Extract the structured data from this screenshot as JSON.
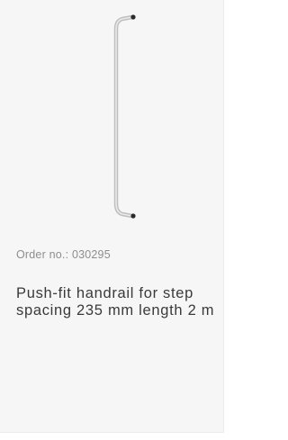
{
  "product": {
    "image_icon": "handrail-image",
    "order_number": "Order no.: 030295",
    "title": "Push-fit handrail for step spacing 235 mm length 2 m"
  }
}
